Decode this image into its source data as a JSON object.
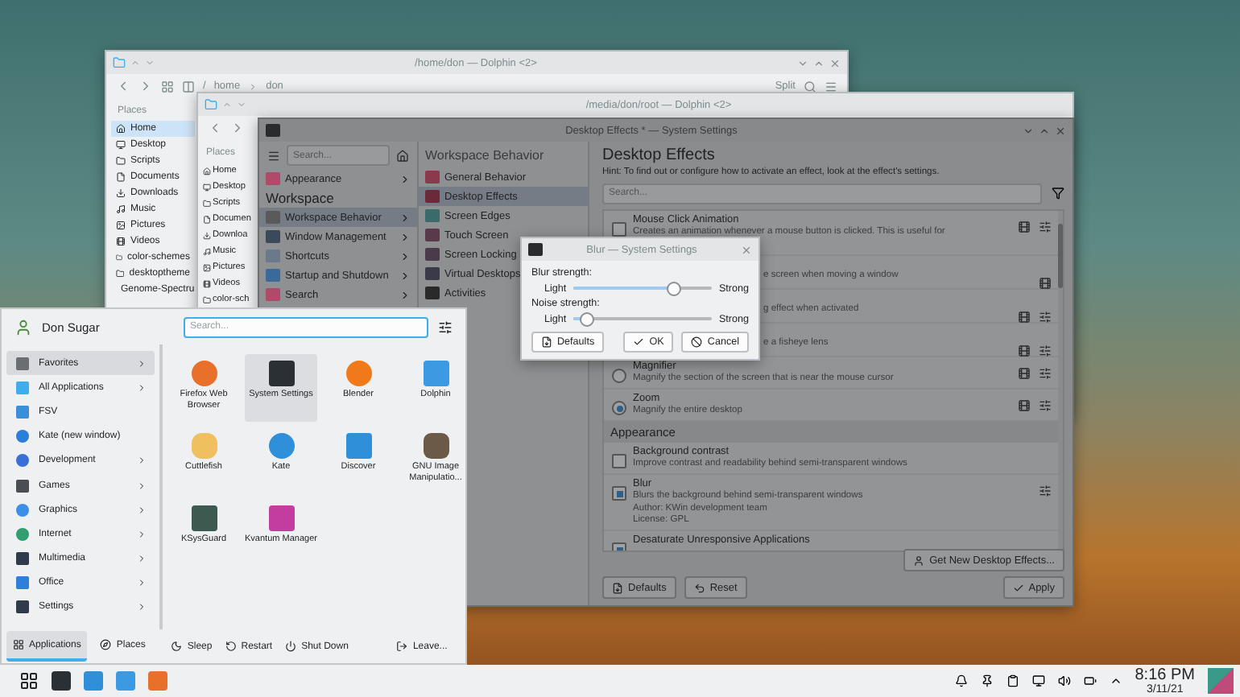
{
  "dolphins": [
    {
      "title": "/home/don — Dolphin <2>",
      "path": [
        "/",
        "home",
        "don"
      ],
      "split_label": "Split",
      "places_heading": "Places",
      "places": [
        {
          "label": "Home",
          "selected": true
        },
        {
          "label": "Desktop",
          "selected": false
        },
        {
          "label": "Scripts",
          "selected": false
        },
        {
          "label": "Documents",
          "selected": false
        },
        {
          "label": "Downloads",
          "selected": false
        },
        {
          "label": "Music",
          "selected": false
        },
        {
          "label": "Pictures",
          "selected": false
        },
        {
          "label": "Videos",
          "selected": false
        },
        {
          "label": "color-schemes",
          "selected": false
        },
        {
          "label": "desktoptheme",
          "selected": false
        },
        {
          "label": "Genome-Spectru",
          "selected": false
        }
      ]
    },
    {
      "title": "/media/don/root — Dolphin <2>",
      "places_heading": "Places",
      "places": [
        {
          "label": "Home",
          "selected": false
        },
        {
          "label": "Desktop",
          "selected": false
        },
        {
          "label": "Scripts",
          "selected": false
        },
        {
          "label": "Documen",
          "selected": false
        },
        {
          "label": "Downloa",
          "selected": false
        },
        {
          "label": "Music",
          "selected": false
        },
        {
          "label": "Pictures",
          "selected": false
        },
        {
          "label": "Videos",
          "selected": false
        },
        {
          "label": "color-sch",
          "selected": false
        }
      ]
    }
  ],
  "settings": {
    "title": "Desktop Effects * — System Settings",
    "dimmed": true,
    "search_placeholder": "Search...",
    "categories": [
      {
        "kind": "item",
        "label": "Appearance",
        "selected": false
      },
      {
        "kind": "heading",
        "label": "Workspace"
      },
      {
        "kind": "item",
        "label": "Workspace Behavior",
        "selected": true
      },
      {
        "kind": "item",
        "label": "Window Management",
        "selected": false
      },
      {
        "kind": "item",
        "label": "Shortcuts",
        "selected": false
      },
      {
        "kind": "item",
        "label": "Startup and Shutdown",
        "selected": false
      },
      {
        "kind": "item",
        "label": "Search",
        "selected": false
      }
    ],
    "subheading": "Workspace Behavior",
    "subcategories": [
      {
        "label": "General Behavior",
        "selected": false
      },
      {
        "label": "Desktop Effects",
        "selected": true
      },
      {
        "label": "Screen Edges",
        "selected": false
      },
      {
        "label": "Touch Screen",
        "selected": false
      },
      {
        "label": "Screen Locking",
        "selected": false
      },
      {
        "label": "Virtual Desktops",
        "selected": false
      },
      {
        "label": "Activities",
        "selected": false
      }
    ],
    "page_title": "Desktop Effects",
    "hint": "Hint: To find out or configure how to activate an effect, look at the effect's settings.",
    "effects_search_placeholder": "Search...",
    "effects": [
      {
        "kind": "checkbox",
        "checked": false,
        "name": "Mouse Click Animation",
        "description": "Creates an animation whenever a mouse button is clicked. This is useful for",
        "video": true,
        "configure": true
      },
      {
        "kind": "covered",
        "description": "e screen when moving a window",
        "video": true,
        "configure": false
      },
      {
        "kind": "covered",
        "description": "g effect when activated",
        "video": true,
        "configure": true
      },
      {
        "kind": "covered",
        "description": "e a fisheye lens",
        "video": true,
        "configure": true
      },
      {
        "kind": "radio",
        "checked": false,
        "name": "Magnifier",
        "description": "Magnify the section of the screen that is near the mouse cursor",
        "video": true,
        "configure": true
      },
      {
        "kind": "radio",
        "checked": true,
        "name": "Zoom",
        "description": "Magnify the entire desktop",
        "video": true,
        "configure": true
      },
      {
        "kind": "section",
        "name": "Appearance"
      },
      {
        "kind": "checkbox",
        "checked": false,
        "name": "Background contrast",
        "description": "Improve contrast and readability behind semi-transparent windows",
        "video": false,
        "configure": false
      },
      {
        "kind": "checkbox",
        "checked": true,
        "name": "Blur",
        "description": "Blurs the background behind semi-transparent windows",
        "details": [
          "Author: KWin development team",
          "License: GPL"
        ],
        "video": false,
        "configure": true
      },
      {
        "kind": "checkbox",
        "checked": true,
        "name": "Desaturate Unresponsive Applications",
        "video": false,
        "configure": false
      }
    ],
    "get_new_label": "Get New Desktop Effects...",
    "buttons": [
      {
        "kind": "defaults",
        "label": "Defaults"
      },
      {
        "kind": "reset",
        "label": "Reset"
      },
      {
        "kind": "apply",
        "label": "Apply"
      }
    ]
  },
  "dialog": {
    "title": "Blur — System Settings",
    "sliders": [
      {
        "label": "Blur strength:",
        "min_label": "Light",
        "max_label": "Strong",
        "level": 0.72
      },
      {
        "label": "Noise strength:",
        "min_label": "Light",
        "max_label": "Strong",
        "level": 0.1
      }
    ],
    "buttons": [
      {
        "kind": "defaults",
        "label": "Defaults"
      },
      {
        "kind": "ok",
        "label": "OK"
      },
      {
        "kind": "cancel",
        "label": "Cancel"
      }
    ]
  },
  "launcher": {
    "user": "Don Sugar",
    "search_placeholder": "Search...",
    "categories": [
      {
        "label": "Favorites",
        "selected": true,
        "submenu": true
      },
      {
        "label": "All Applications",
        "selected": false,
        "submenu": true
      },
      {
        "label": "FSV",
        "selected": false,
        "submenu": false
      },
      {
        "label": "Kate (new window)",
        "selected": false,
        "submenu": false
      },
      {
        "label": "Development",
        "selected": false,
        "submenu": true
      },
      {
        "label": "Games",
        "selected": false,
        "submenu": true
      },
      {
        "label": "Graphics",
        "selected": false,
        "submenu": true
      },
      {
        "label": "Internet",
        "selected": false,
        "submenu": true
      },
      {
        "label": "Multimedia",
        "selected": false,
        "submenu": true
      },
      {
        "label": "Office",
        "selected": false,
        "submenu": true
      },
      {
        "label": "Settings",
        "selected": false,
        "submenu": true
      }
    ],
    "apps": [
      {
        "name": "Firefox Web Browser",
        "selected": false
      },
      {
        "name": "System Settings",
        "selected": true
      },
      {
        "name": "Blender",
        "selected": false
      },
      {
        "name": "Dolphin",
        "selected": false
      },
      {
        "name": "Cuttlefish",
        "selected": false
      },
      {
        "name": "Kate",
        "selected": false
      },
      {
        "name": "Discover",
        "selected": false
      },
      {
        "name": "GNU Image Manipulatio...",
        "selected": false
      },
      {
        "name": "KSysGuard",
        "selected": false
      },
      {
        "name": "Kvantum Manager",
        "selected": false
      }
    ],
    "tabs": [
      {
        "label": "Applications",
        "selected": true
      },
      {
        "label": "Places",
        "selected": false
      }
    ],
    "actions": [
      {
        "kind": "sleep",
        "label": "Sleep"
      },
      {
        "kind": "restart",
        "label": "Restart"
      },
      {
        "kind": "shutdown",
        "label": "Shut Down"
      },
      {
        "kind": "leave",
        "label": "Leave..."
      }
    ]
  },
  "taskbar": {
    "time": "8:16 PM",
    "date": "3/11/21"
  }
}
